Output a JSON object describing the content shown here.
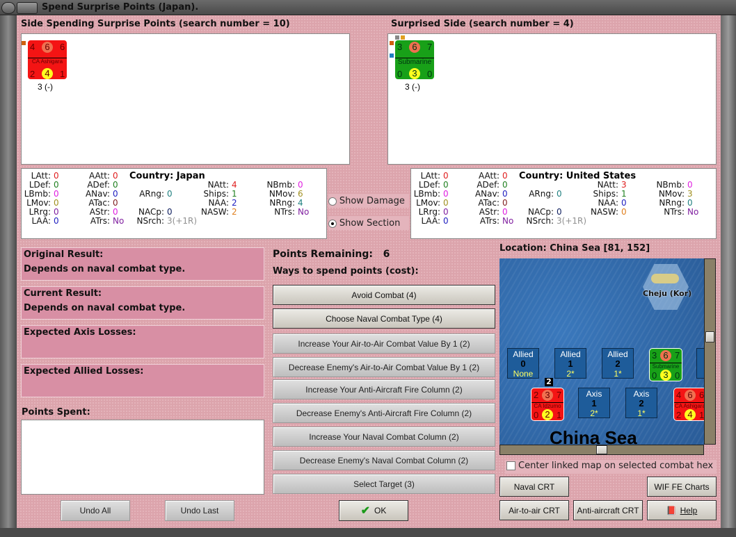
{
  "window": {
    "title": "Spend Surprise Points (Japan)."
  },
  "left": {
    "header": "Side Spending Surprise Points (search number = 10)",
    "unit": {
      "name": "CA Ashigara",
      "tl": "4",
      "tc": "6",
      "tr": "6",
      "bl": "2",
      "bc": "4",
      "br": "1",
      "caption": "3 (-)",
      "color": "#f41414"
    }
  },
  "right": {
    "header": "Surprised Side (search number = 4)",
    "unit": {
      "name": "Submarine",
      "tl": "3",
      "tc": "6",
      "tr": "7",
      "bl": "0",
      "bc": "3",
      "br": "0",
      "caption": "3 (-)",
      "color": "#18a018"
    }
  },
  "stats_left": {
    "country": "Country: Japan",
    "cols": [
      [
        {
          "l": "LAtt:",
          "v": "0",
          "c": "#e02020"
        },
        {
          "l": "LDef:",
          "v": "0",
          "c": "#208020"
        },
        {
          "l": "LBmb:",
          "v": "0",
          "c": "#e020e0"
        },
        {
          "l": "LMov:",
          "v": "0",
          "c": "#a09020"
        },
        {
          "l": "LRrg:",
          "v": "0",
          "c": "#8020a0"
        },
        {
          "l": "LAA:",
          "v": "0",
          "c": "#2020c0"
        }
      ],
      [
        {
          "l": "AAtt:",
          "v": "0",
          "c": "#e02020"
        },
        {
          "l": "ADef:",
          "v": "0",
          "c": "#208020"
        },
        {
          "l": "ANav:",
          "v": "0",
          "c": "#2020c0"
        },
        {
          "l": "ATac:",
          "v": "0",
          "c": "#802020"
        },
        {
          "l": "AStr:",
          "v": "0",
          "c": "#e020e0"
        },
        {
          "l": "ATrs:",
          "v": "No",
          "c": "#8020a0"
        }
      ],
      [
        null,
        null,
        {
          "l": "ARng:",
          "v": "0",
          "c": "#208080"
        },
        null,
        {
          "l": "NACp:",
          "v": "0",
          "c": "#102060"
        },
        {
          "l": "NSrch:",
          "v": "3(+1R)",
          "c": "#909090"
        }
      ],
      [
        null,
        {
          "l": "NAtt:",
          "v": "4",
          "c": "#e02020"
        },
        {
          "l": "Ships:",
          "v": "1",
          "c": "#208020"
        },
        {
          "l": "NAA:",
          "v": "2",
          "c": "#2020c0"
        },
        {
          "l": "NASW:",
          "v": "2",
          "c": "#e08020"
        },
        null
      ],
      [
        null,
        {
          "l": "NBmb:",
          "v": "0",
          "c": "#e020e0"
        },
        {
          "l": "NMov:",
          "v": "6",
          "c": "#a09020"
        },
        {
          "l": "NRng:",
          "v": "4",
          "c": "#208080"
        },
        {
          "l": "NTrs:",
          "v": "No",
          "c": "#8020a0"
        },
        null
      ]
    ]
  },
  "stats_right": {
    "country": "Country: United States",
    "cols": [
      [
        {
          "l": "LAtt:",
          "v": "0",
          "c": "#e02020"
        },
        {
          "l": "LDef:",
          "v": "0",
          "c": "#208020"
        },
        {
          "l": "LBmb:",
          "v": "0",
          "c": "#e020e0"
        },
        {
          "l": "LMov:",
          "v": "0",
          "c": "#a09020"
        },
        {
          "l": "LRrg:",
          "v": "0",
          "c": "#8020a0"
        },
        {
          "l": "LAA:",
          "v": "0",
          "c": "#2020c0"
        }
      ],
      [
        {
          "l": "AAtt:",
          "v": "0",
          "c": "#e02020"
        },
        {
          "l": "ADef:",
          "v": "0",
          "c": "#208020"
        },
        {
          "l": "ANav:",
          "v": "0",
          "c": "#2020c0"
        },
        {
          "l": "ATac:",
          "v": "0",
          "c": "#802020"
        },
        {
          "l": "AStr:",
          "v": "0",
          "c": "#e020e0"
        },
        {
          "l": "ATrs:",
          "v": "No",
          "c": "#8020a0"
        }
      ],
      [
        null,
        null,
        {
          "l": "ARng:",
          "v": "0",
          "c": "#208080"
        },
        null,
        {
          "l": "NACp:",
          "v": "0",
          "c": "#102060"
        },
        {
          "l": "NSrch:",
          "v": "3(+1R)",
          "c": "#909090"
        }
      ],
      [
        null,
        {
          "l": "NAtt:",
          "v": "3",
          "c": "#e02020"
        },
        {
          "l": "Ships:",
          "v": "1",
          "c": "#208020"
        },
        {
          "l": "NAA:",
          "v": "0",
          "c": "#2020c0"
        },
        {
          "l": "NASW:",
          "v": "0",
          "c": "#e08020"
        },
        null
      ],
      [
        null,
        {
          "l": "NBmb:",
          "v": "0",
          "c": "#e020e0"
        },
        {
          "l": "NMov:",
          "v": "3",
          "c": "#a09020"
        },
        {
          "l": "NRng:",
          "v": "0",
          "c": "#208080"
        },
        {
          "l": "NTrs:",
          "v": "No",
          "c": "#8020a0"
        },
        null
      ]
    ]
  },
  "options": {
    "show_damage": "Show Damage",
    "show_section": "Show Section",
    "selected": "Show Section"
  },
  "results": {
    "original_label": "Original Result:",
    "original_value": "Depends on naval combat type.",
    "current_label": "Current Result:",
    "current_value": "Depends on naval combat type.",
    "axis_losses_label": "Expected Axis Losses:",
    "allied_losses_label": "Expected Allied Losses:",
    "points_spent_label": "Points Spent:"
  },
  "undo_all": "Undo All",
  "undo_last": "Undo Last",
  "ok": "OK",
  "points": {
    "remaining_label": "Points Remaining:",
    "remaining_value": "6",
    "ways_label": "Ways to spend points (cost):"
  },
  "actions": [
    {
      "label": "Avoid Combat (4)",
      "enabled": true
    },
    {
      "label": "Choose Naval Combat Type (4)",
      "enabled": true
    },
    {
      "label": "Increase Your Air-to-Air Combat Value By 1 (2)",
      "enabled": false
    },
    {
      "label": "Decrease Enemy's Air-to-Air Combat Value By 1 (2)",
      "enabled": false
    },
    {
      "label": "Increase Your Anti-Aircraft Fire Column (2)",
      "enabled": false
    },
    {
      "label": "Decrease Enemy's Anti-Aircraft Fire Column (2)",
      "enabled": false
    },
    {
      "label": "Increase Your Naval Combat Column (2)",
      "enabled": false
    },
    {
      "label": "Decrease Enemy's Naval Combat Column (2)",
      "enabled": false
    },
    {
      "label": "Select Target (3)",
      "enabled": false
    }
  ],
  "map": {
    "location": "Location: China Sea [81, 152]",
    "hex_label": "Cheju (Kor)",
    "sea_label": "China Sea",
    "allied": [
      {
        "t": "Allied",
        "n": "0",
        "s": "None"
      },
      {
        "t": "Allied",
        "n": "1",
        "s": "2*"
      },
      {
        "t": "Allied",
        "n": "2",
        "s": "1*"
      }
    ],
    "axis": [
      {
        "t": "Axis",
        "n": "1",
        "s": "2*"
      },
      {
        "t": "Axis",
        "n": "2",
        "s": "1*"
      }
    ],
    "idzumo": {
      "name": "CA Idzumo",
      "tl": "2",
      "tc": "3",
      "tr": "7",
      "bl": "0",
      "bc": "2",
      "br": "1",
      "stack": "2"
    },
    "sub": {
      "name": "Submarine",
      "tl": "3",
      "tc": "6",
      "tr": "7",
      "bl": "0",
      "bc": "3",
      "br": "0"
    },
    "ashigara": {
      "name": "CA Ashigara",
      "tl": "4",
      "tc": "6",
      "tr": "6",
      "bl": "2",
      "bc": "4",
      "br": "1"
    }
  },
  "center_map": {
    "label": "Center linked map on selected combat hex",
    "checked": false
  },
  "crt": {
    "naval": "Naval CRT",
    "wif": "WIF FE Charts",
    "air": "Air-to-air CRT",
    "aa": "Anti-aircraft CRT",
    "help": "Help"
  }
}
